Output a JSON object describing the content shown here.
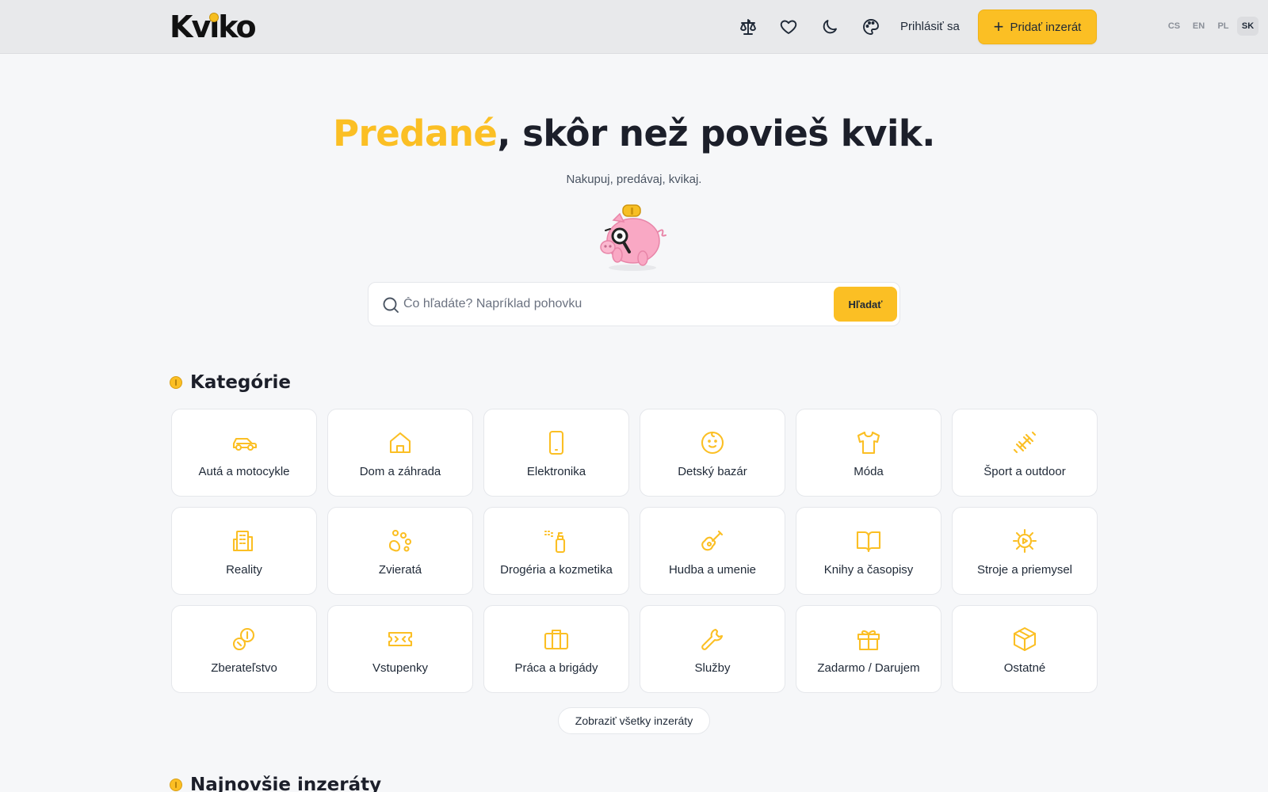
{
  "header": {
    "logo_text": "Kviko",
    "icons": [
      "compare-scales-icon",
      "heart-icon",
      "moon-icon",
      "palette-icon"
    ],
    "login_label": "Prihlásiť sa",
    "add_listing_label": "Pridať inzerát",
    "languages": [
      "CS",
      "EN",
      "PL",
      "SK"
    ],
    "active_language": "SK"
  },
  "hero": {
    "title_accent": "Predané",
    "title_rest": ", skôr než povieš kvik.",
    "subtitle": "Nakupuj, predávaj, kvikaj."
  },
  "search": {
    "placeholder": "Čo hľadáte? Napríklad pohovku",
    "value": "",
    "button_label": "Hľadať"
  },
  "categories_section": {
    "heading": "Kategórie",
    "items": [
      {
        "label": "Autá a motocykle",
        "icon": "car-icon"
      },
      {
        "label": "Dom a záhrada",
        "icon": "house-icon"
      },
      {
        "label": "Elektronika",
        "icon": "smartphone-icon"
      },
      {
        "label": "Detský bazár",
        "icon": "baby-icon"
      },
      {
        "label": "Móda",
        "icon": "shirt-icon"
      },
      {
        "label": "Šport a outdoor",
        "icon": "dumbbell-icon"
      },
      {
        "label": "Reality",
        "icon": "building-icon"
      },
      {
        "label": "Zvieratá",
        "icon": "paw-icon"
      },
      {
        "label": "Drogéria a kozmetika",
        "icon": "spray-bottle-icon"
      },
      {
        "label": "Hudba a umenie",
        "icon": "guitar-icon"
      },
      {
        "label": "Knihy a časopisy",
        "icon": "book-icon"
      },
      {
        "label": "Stroje a priemysel",
        "icon": "cog-icon"
      },
      {
        "label": "Zberateľstvo",
        "icon": "coins-icon"
      },
      {
        "label": "Vstupenky",
        "icon": "ticket-icon"
      },
      {
        "label": "Práca a brigády",
        "icon": "briefcase-icon"
      },
      {
        "label": "Služby",
        "icon": "wrench-icon"
      },
      {
        "label": "Zadarmo / Darujem",
        "icon": "gift-icon"
      },
      {
        "label": "Ostatné",
        "icon": "package-icon"
      }
    ],
    "show_all_label": "Zobraziť všetky inzeráty"
  },
  "latest_section": {
    "heading": "Najnovšie inzeráty"
  },
  "colors": {
    "accent": "#fbbf24",
    "header_bg": "#e8e9eb",
    "page_bg": "#f6f7f9",
    "text_dark": "#1c1f2a"
  }
}
